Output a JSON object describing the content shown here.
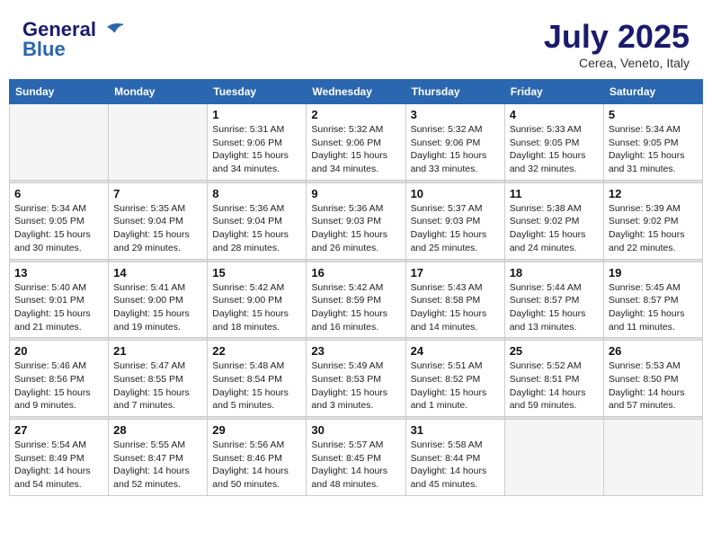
{
  "header": {
    "logo_general": "General",
    "logo_blue": "Blue",
    "month_title": "July 2025",
    "subtitle": "Cerea, Veneto, Italy"
  },
  "weekdays": [
    "Sunday",
    "Monday",
    "Tuesday",
    "Wednesday",
    "Thursday",
    "Friday",
    "Saturday"
  ],
  "weeks": [
    [
      {
        "day": "",
        "info": ""
      },
      {
        "day": "",
        "info": ""
      },
      {
        "day": "1",
        "info": "Sunrise: 5:31 AM\nSunset: 9:06 PM\nDaylight: 15 hours\nand 34 minutes."
      },
      {
        "day": "2",
        "info": "Sunrise: 5:32 AM\nSunset: 9:06 PM\nDaylight: 15 hours\nand 34 minutes."
      },
      {
        "day": "3",
        "info": "Sunrise: 5:32 AM\nSunset: 9:06 PM\nDaylight: 15 hours\nand 33 minutes."
      },
      {
        "day": "4",
        "info": "Sunrise: 5:33 AM\nSunset: 9:05 PM\nDaylight: 15 hours\nand 32 minutes."
      },
      {
        "day": "5",
        "info": "Sunrise: 5:34 AM\nSunset: 9:05 PM\nDaylight: 15 hours\nand 31 minutes."
      }
    ],
    [
      {
        "day": "6",
        "info": "Sunrise: 5:34 AM\nSunset: 9:05 PM\nDaylight: 15 hours\nand 30 minutes."
      },
      {
        "day": "7",
        "info": "Sunrise: 5:35 AM\nSunset: 9:04 PM\nDaylight: 15 hours\nand 29 minutes."
      },
      {
        "day": "8",
        "info": "Sunrise: 5:36 AM\nSunset: 9:04 PM\nDaylight: 15 hours\nand 28 minutes."
      },
      {
        "day": "9",
        "info": "Sunrise: 5:36 AM\nSunset: 9:03 PM\nDaylight: 15 hours\nand 26 minutes."
      },
      {
        "day": "10",
        "info": "Sunrise: 5:37 AM\nSunset: 9:03 PM\nDaylight: 15 hours\nand 25 minutes."
      },
      {
        "day": "11",
        "info": "Sunrise: 5:38 AM\nSunset: 9:02 PM\nDaylight: 15 hours\nand 24 minutes."
      },
      {
        "day": "12",
        "info": "Sunrise: 5:39 AM\nSunset: 9:02 PM\nDaylight: 15 hours\nand 22 minutes."
      }
    ],
    [
      {
        "day": "13",
        "info": "Sunrise: 5:40 AM\nSunset: 9:01 PM\nDaylight: 15 hours\nand 21 minutes."
      },
      {
        "day": "14",
        "info": "Sunrise: 5:41 AM\nSunset: 9:00 PM\nDaylight: 15 hours\nand 19 minutes."
      },
      {
        "day": "15",
        "info": "Sunrise: 5:42 AM\nSunset: 9:00 PM\nDaylight: 15 hours\nand 18 minutes."
      },
      {
        "day": "16",
        "info": "Sunrise: 5:42 AM\nSunset: 8:59 PM\nDaylight: 15 hours\nand 16 minutes."
      },
      {
        "day": "17",
        "info": "Sunrise: 5:43 AM\nSunset: 8:58 PM\nDaylight: 15 hours\nand 14 minutes."
      },
      {
        "day": "18",
        "info": "Sunrise: 5:44 AM\nSunset: 8:57 PM\nDaylight: 15 hours\nand 13 minutes."
      },
      {
        "day": "19",
        "info": "Sunrise: 5:45 AM\nSunset: 8:57 PM\nDaylight: 15 hours\nand 11 minutes."
      }
    ],
    [
      {
        "day": "20",
        "info": "Sunrise: 5:46 AM\nSunset: 8:56 PM\nDaylight: 15 hours\nand 9 minutes."
      },
      {
        "day": "21",
        "info": "Sunrise: 5:47 AM\nSunset: 8:55 PM\nDaylight: 15 hours\nand 7 minutes."
      },
      {
        "day": "22",
        "info": "Sunrise: 5:48 AM\nSunset: 8:54 PM\nDaylight: 15 hours\nand 5 minutes."
      },
      {
        "day": "23",
        "info": "Sunrise: 5:49 AM\nSunset: 8:53 PM\nDaylight: 15 hours\nand 3 minutes."
      },
      {
        "day": "24",
        "info": "Sunrise: 5:51 AM\nSunset: 8:52 PM\nDaylight: 15 hours\nand 1 minute."
      },
      {
        "day": "25",
        "info": "Sunrise: 5:52 AM\nSunset: 8:51 PM\nDaylight: 14 hours\nand 59 minutes."
      },
      {
        "day": "26",
        "info": "Sunrise: 5:53 AM\nSunset: 8:50 PM\nDaylight: 14 hours\nand 57 minutes."
      }
    ],
    [
      {
        "day": "27",
        "info": "Sunrise: 5:54 AM\nSunset: 8:49 PM\nDaylight: 14 hours\nand 54 minutes."
      },
      {
        "day": "28",
        "info": "Sunrise: 5:55 AM\nSunset: 8:47 PM\nDaylight: 14 hours\nand 52 minutes."
      },
      {
        "day": "29",
        "info": "Sunrise: 5:56 AM\nSunset: 8:46 PM\nDaylight: 14 hours\nand 50 minutes."
      },
      {
        "day": "30",
        "info": "Sunrise: 5:57 AM\nSunset: 8:45 PM\nDaylight: 14 hours\nand 48 minutes."
      },
      {
        "day": "31",
        "info": "Sunrise: 5:58 AM\nSunset: 8:44 PM\nDaylight: 14 hours\nand 45 minutes."
      },
      {
        "day": "",
        "info": ""
      },
      {
        "day": "",
        "info": ""
      }
    ]
  ]
}
